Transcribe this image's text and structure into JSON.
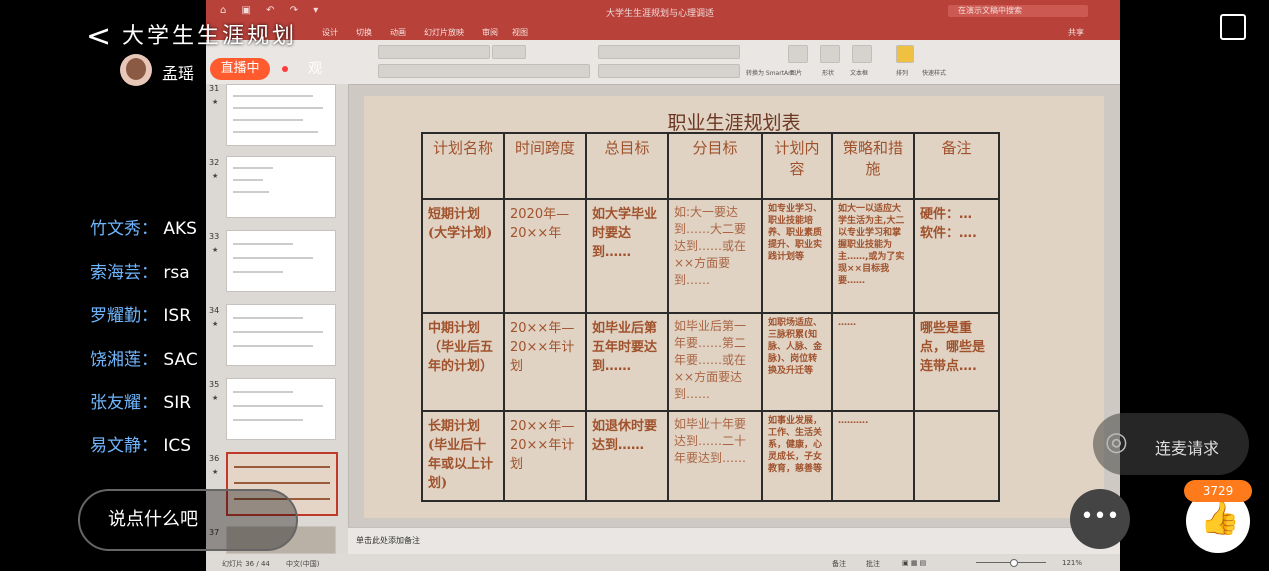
{
  "stream": {
    "title": "大学生生涯规划",
    "host_name": "孟瑶",
    "live_label": "直播中",
    "viewers": "观",
    "input_placeholder": "说点什么吧",
    "connect_request": "连麦请求",
    "like_count": "3729",
    "more_label": "•••"
  },
  "chat": [
    {
      "name": "竹文秀",
      "sep": "：",
      "msg": "AKS"
    },
    {
      "name": "索海芸",
      "sep": "：",
      "msg": "rsa"
    },
    {
      "name": "罗耀勤",
      "sep": "：",
      "msg": "ISR"
    },
    {
      "name": "饶湘莲",
      "sep": "：",
      "msg": "SAC"
    },
    {
      "name": "张友耀",
      "sep": "：",
      "msg": "SIR"
    },
    {
      "name": "易文静",
      "sep": "：",
      "msg": "ICS"
    }
  ],
  "ppt": {
    "doc_title": "大学生生涯规划与心理调适",
    "search_placeholder": "在演示文稿中搜索",
    "tabs": [
      "设计",
      "切换",
      "动画",
      "幻灯片放映",
      "审阅",
      "视图"
    ],
    "share_label": "共享",
    "notes_placeholder": "单击此处添加备注",
    "status_left": "幻灯片 36 / 44",
    "status_lang": "中文(中国)",
    "status_notes": "备注",
    "status_comments": "批注",
    "zoom": "121%",
    "ribbon_labels": [
      "图片",
      "形状",
      "文本框",
      "排列",
      "快速样式",
      "转换为 SmartArt"
    ],
    "thumb_numbers": [
      "31",
      "32",
      "33",
      "34",
      "35",
      "36",
      "37"
    ]
  },
  "slide": {
    "title": "职业生涯规划表",
    "headers": [
      "计划名称",
      "时间跨度",
      "总目标",
      "分目标",
      "计划内容",
      "策略和措施",
      "备注"
    ],
    "rows": [
      {
        "name": "短期计划(大学计划)",
        "time": "2020年—20××年",
        "goal": "如大学毕业时要达到……",
        "sub": "如:大一要达到……大二要达到……或在××方面要到……",
        "content": "如专业学习、职业技能培养、职业素质提升、职业实践计划等",
        "strategy": "如大一以适应大学生活为主,大二以专业学习和掌握职业技能为主……,或为了实现××目标我要……",
        "note": "硬件：…\n软件：…."
      },
      {
        "name": "中期计划（毕业后五年的计划）",
        "time": "20××年—20××年计划",
        "goal": "如毕业后第五年时要达到……",
        "sub": "如毕业后第一年要……第二年要……或在××方面要达到……",
        "content": "如职场适应、三脉积累(知脉、人脉、金脉)、岗位转换及升迁等",
        "strategy": "……",
        "note": "哪些是重点，哪些是连带点…."
      },
      {
        "name": "长期计划(毕业后十年或以上计划)",
        "time": "20××年—20××年计划",
        "goal": "如退休时要达到……",
        "sub": "如毕业十年要达到……二十年要达到……",
        "content": "如事业发展，工作、生活关系，健康，心灵成长，子女教育，慈善等",
        "strategy": "……….",
        "note": ""
      }
    ]
  }
}
